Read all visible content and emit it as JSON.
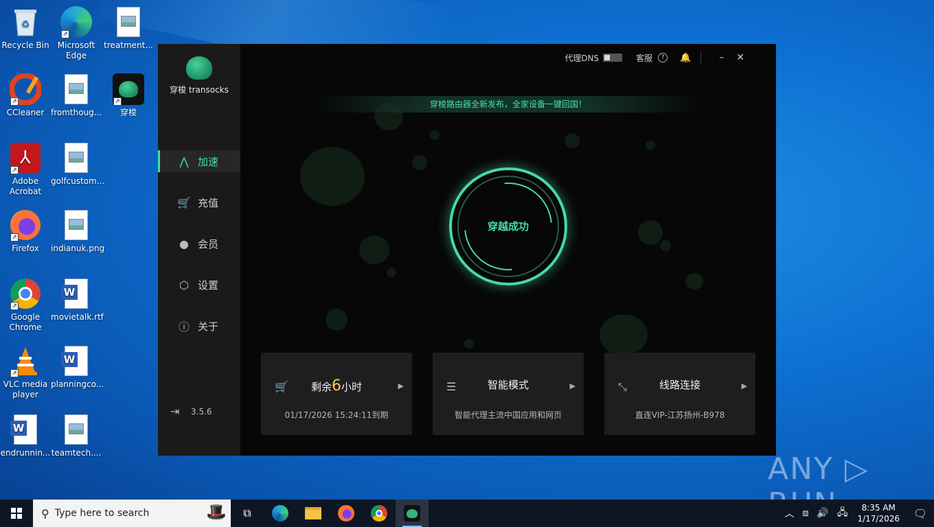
{
  "desktop": {
    "icons": [
      {
        "label": "Recycle Bin"
      },
      {
        "label": "Microsoft Edge"
      },
      {
        "label": "treatment..."
      },
      {
        "label": "CCleaner"
      },
      {
        "label": "fromthoug..."
      },
      {
        "label": "穿梭"
      },
      {
        "label": "Adobe Acrobat"
      },
      {
        "label": "golfcustom..."
      },
      {
        "label": "Firefox"
      },
      {
        "label": "indianuk.png"
      },
      {
        "label": "Google Chrome"
      },
      {
        "label": "movietalk.rtf"
      },
      {
        "label": "VLC media player"
      },
      {
        "label": "planningco..."
      },
      {
        "label": "endrunnin..."
      },
      {
        "label": "teamtech...."
      }
    ]
  },
  "app": {
    "logo_text": "穿梭 transocks",
    "topbar": {
      "dns_label": "代理DNS",
      "service_label": "客服",
      "minimize": "–",
      "close": "✕"
    },
    "banner": "穿梭路由器全新发布，全家设备一键回国！",
    "nav": [
      {
        "label": "加速",
        "icon": "accelerate-icon",
        "active": true
      },
      {
        "label": "充值",
        "icon": "cart-icon",
        "active": false
      },
      {
        "label": "会员",
        "icon": "member-icon",
        "active": false
      },
      {
        "label": "设置",
        "icon": "settings-icon",
        "active": false
      },
      {
        "label": "关于",
        "icon": "info-icon",
        "active": false
      }
    ],
    "version": "3.5.6",
    "status": "穿越成功",
    "cards": {
      "remaining": {
        "prefix": "剩余",
        "value": "6",
        "suffix": "小时",
        "sub": "01/17/2026 15:24:11到期"
      },
      "mode": {
        "title": "智能模式",
        "sub": "智能代理主流中国应用和网页"
      },
      "route": {
        "title": "线路连接",
        "sub": "直连VIP-江苏扬州-B978"
      }
    },
    "accent_color": "#46d9a6"
  },
  "taskbar": {
    "search_placeholder": "Type here to search",
    "time": "8:35 AM",
    "date": "1/17/2026"
  },
  "watermark": "ANY ▷ RUN"
}
